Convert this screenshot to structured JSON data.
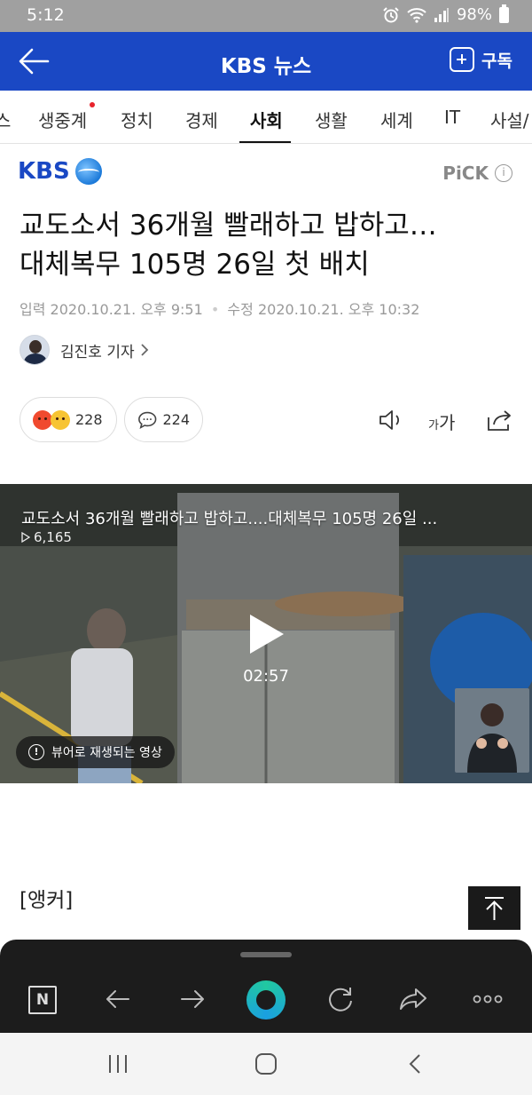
{
  "status_bar": {
    "time": "5:12",
    "battery": "98%"
  },
  "app_bar": {
    "title": "KBS 뉴스",
    "subscribe_label": "구독"
  },
  "tabs": {
    "partial_left": "스",
    "items": [
      "생중계",
      "정치",
      "경제",
      "사회",
      "생활",
      "세계",
      "IT",
      "사설/"
    ],
    "active": "사회"
  },
  "article": {
    "publisher_logo": "KBS",
    "pick_label": "PiCK",
    "pick_info": "i",
    "headline_line1": "교도소서 36개월 빨래하고 밥하고…",
    "headline_line2": "대체복무 105명 26일 첫 배치",
    "input_label": "입력",
    "input_time": "2020.10.21. 오후 9:51",
    "modified_label": "수정",
    "modified_time": "2020.10.21. 오후 10:32",
    "reporter": "김진호 기자",
    "reaction_count": "228",
    "comment_count": "224",
    "text_size_small": "가",
    "text_size_large": "가"
  },
  "video": {
    "title": "교도소서 36개월 빨래하고 밥하고....대체복무 105명 26일 ...",
    "views": "6,165",
    "duration": "02:57",
    "viewer_notice": "뷰어로 재생되는 영상"
  },
  "body": {
    "first_paragraph": "[앵커]"
  },
  "icons": {
    "back": "arrow-left-icon",
    "subscribe": "plus-box-icon",
    "speaker": "speaker-icon",
    "share": "share-icon",
    "scroll_top": "arrow-up-icon"
  },
  "colors": {
    "brand_blue": "#1a48c4",
    "live_dot": "#e8232c"
  }
}
